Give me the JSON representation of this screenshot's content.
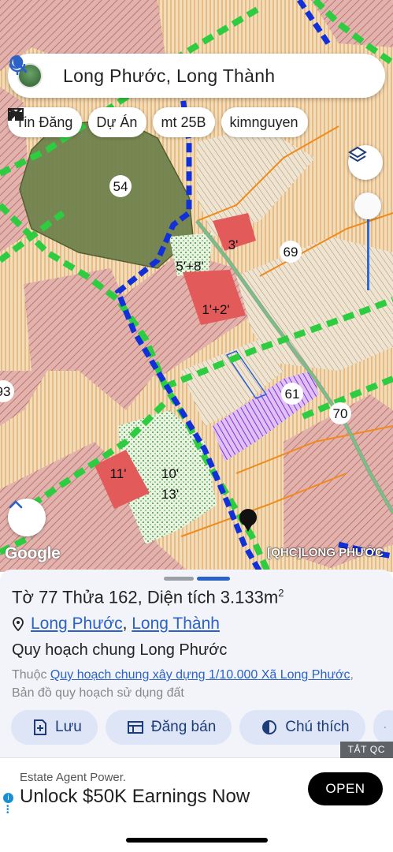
{
  "search": {
    "query": "Long Phước, Long Thành"
  },
  "chips": [
    {
      "label": "Tin Đăng",
      "icon": "newspaper-icon"
    },
    {
      "label": "Dự Án",
      "icon": "building-icon"
    },
    {
      "label": "mt 25B",
      "icon": "tools-icon"
    },
    {
      "label": "kimnguyen",
      "icon": "tools-icon"
    }
  ],
  "map": {
    "watermark": "Google",
    "tag": "[QHC]LONG PHƯỚC",
    "labels": [
      "54",
      "69",
      "61",
      "70",
      "93",
      "3'",
      "5'+8'",
      "1'+2'",
      "11'",
      "10'",
      "13'"
    ]
  },
  "sheet": {
    "title_prefix": "Tờ 77 Thửa ",
    "parcel": "162",
    "area_text": ", Diện tích 3.133m",
    "area_sup": "2",
    "location_ward": "Long Phước",
    "location_sep": ", ",
    "location_district": "Long Thành",
    "plan_name": "Quy hoạch chung Long Phước",
    "note_prefix": "Thuộc ",
    "note_link": "Quy hoạch chung xây dựng 1/10.000 Xã Long Phước",
    "note_suffix": ", Bản đồ quy hoạch sử dụng đất",
    "buttons": [
      {
        "label": "Lưu",
        "icon": "save-icon"
      },
      {
        "label": "Đăng bán",
        "icon": "listing-icon"
      },
      {
        "label": "Chú thích",
        "icon": "legend-icon"
      }
    ]
  },
  "ad": {
    "close_label": "TẮT QC",
    "subtitle": "Estate Agent Power.",
    "title": "Unlock $50K Earnings Now",
    "cta": "OPEN"
  },
  "colors": {
    "accent": "#2a62c9",
    "road": "#2ecc40",
    "boundary": "#1230d8",
    "residential": "#c98a8a",
    "agri": "#e7b985"
  }
}
